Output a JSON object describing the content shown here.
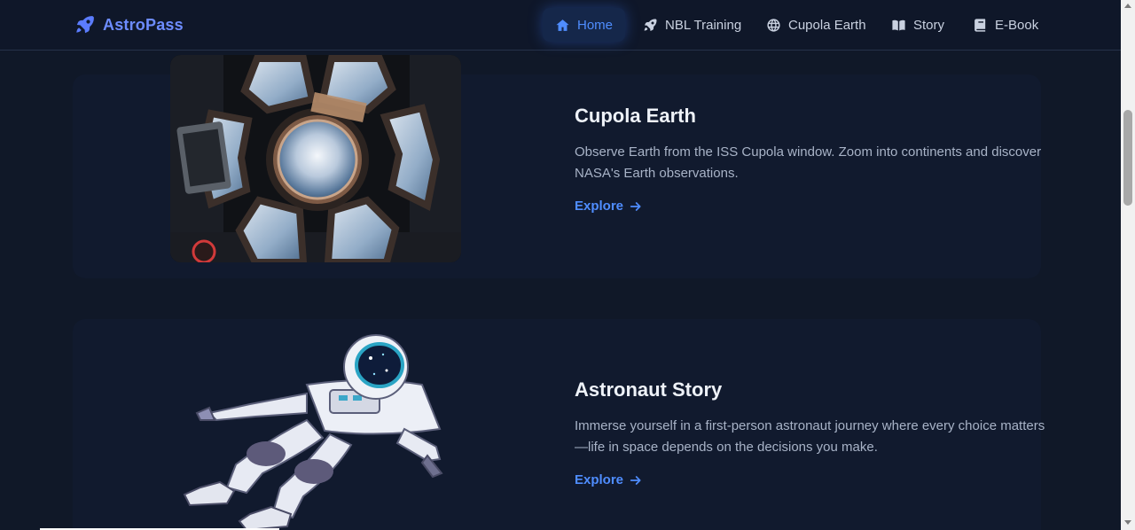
{
  "brand": {
    "name": "AstroPass",
    "icon": "rocket-icon",
    "color": "#6d8cff"
  },
  "nav": {
    "items": [
      {
        "label": "Home",
        "icon": "home-icon",
        "active": true
      },
      {
        "label": "NBL Training",
        "icon": "rocket-icon",
        "active": false
      },
      {
        "label": "Cupola Earth",
        "icon": "globe-icon",
        "active": false
      },
      {
        "label": "Story",
        "icon": "book-open-icon",
        "active": false
      },
      {
        "label": "E-Book",
        "icon": "book-icon",
        "active": false
      }
    ]
  },
  "features": [
    {
      "title": "Cupola Earth",
      "description": "Observe Earth from the ISS Cupola window. Zoom into continents and discover NASA's Earth observations.",
      "cta": "Explore",
      "image": "iss-cupola-window-image"
    },
    {
      "title": "Astronaut Story",
      "description": "Immerse yourself in a first-person astronaut journey where every choice matters—life in space depends on the decisions you make.",
      "cta": "Explore",
      "image": "floating-astronaut-image"
    }
  ],
  "colors": {
    "accent": "#4f8dff",
    "background": "#101828",
    "text": "#eef2f8",
    "muted": "#a8b3c7"
  }
}
